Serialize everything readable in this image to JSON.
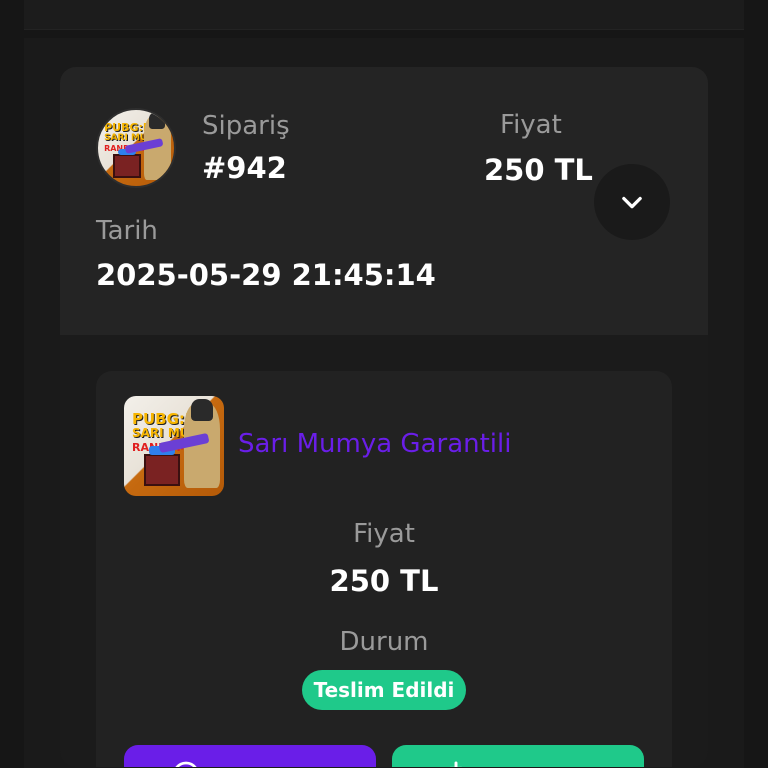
{
  "order": {
    "order_label": "Sipariş",
    "order_number": "#942",
    "price_label": "Fiyat",
    "price_value": "250 TL",
    "date_label": "Tarih",
    "date_value": "2025-05-29 21:45:14",
    "expand_icon": "chevron-down-icon"
  },
  "item": {
    "thumbnail_text": [
      "PUBG:M",
      "SARI MUMYA",
      "RANDOM"
    ],
    "product_title": "Sarı Mumya Garantili",
    "price_label": "Fiyat",
    "price_value": "250 TL",
    "status_label": "Durum",
    "status_value": "Teslim Edildi"
  },
  "actions": {
    "primary_icon": "chat-icon",
    "secondary_icon": "review-icon"
  },
  "colors": {
    "accent_purple": "#6a1ee8",
    "status_green": "#1fc98a",
    "background": "#161616",
    "card": "#242424"
  }
}
